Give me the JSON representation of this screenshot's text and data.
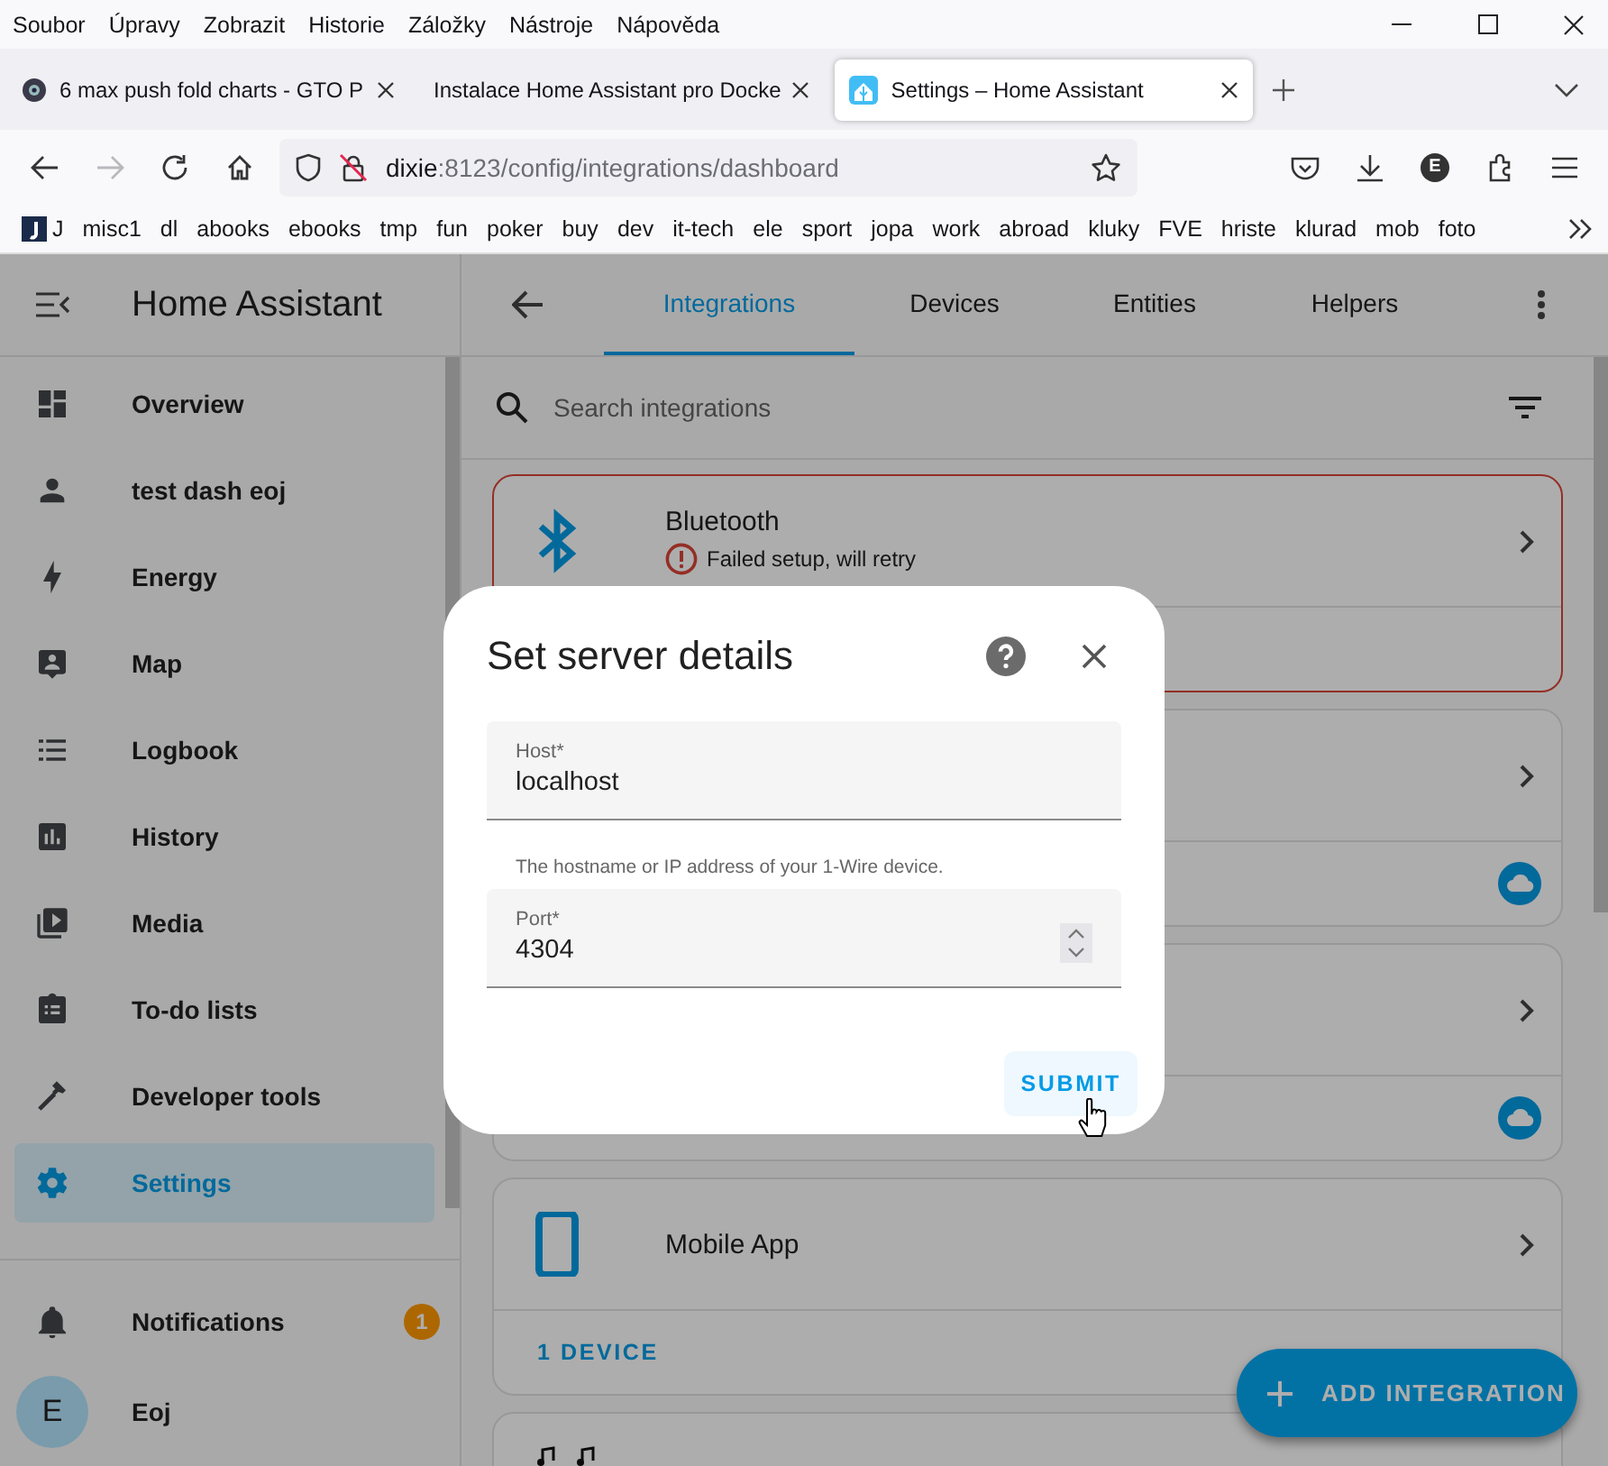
{
  "browser": {
    "menu": [
      "Soubor",
      "Úpravy",
      "Zobrazit",
      "Historie",
      "Záložky",
      "Nástroje",
      "Nápověda"
    ],
    "tabs": [
      {
        "title": "6 max push fold charts - GTO P",
        "selected": false
      },
      {
        "title": "Instalace Home Assistant pro Docke",
        "selected": false
      },
      {
        "title": "Settings – Home Assistant",
        "selected": true
      }
    ],
    "address": {
      "host": "dixie",
      "path": ":8123/config/integrations/dashboard"
    },
    "forward_disabled": true,
    "account_initial": "E",
    "bookmarks": [
      "J",
      "misc1",
      "dl",
      "abooks",
      "ebooks",
      "tmp",
      "fun",
      "poker",
      "buy",
      "dev",
      "it-tech",
      "ele",
      "sport",
      "jopa",
      "work",
      "abroad",
      "kluky",
      "FVE",
      "hriste",
      "klurad",
      "mob",
      "foto"
    ]
  },
  "app": {
    "title": "Home Assistant",
    "sidebar": [
      {
        "label": "Overview",
        "selected": false
      },
      {
        "label": "test dash eoj",
        "selected": false
      },
      {
        "label": "Energy",
        "selected": false
      },
      {
        "label": "Map",
        "selected": false
      },
      {
        "label": "Logbook",
        "selected": false
      },
      {
        "label": "History",
        "selected": false
      },
      {
        "label": "Media",
        "selected": false
      },
      {
        "label": "To-do lists",
        "selected": false
      },
      {
        "label": "Developer tools",
        "selected": false
      },
      {
        "label": "Settings",
        "selected": true
      }
    ],
    "notifications": {
      "label": "Notifications",
      "badge": "1"
    },
    "user": {
      "label": "Eoj",
      "initial": "E"
    }
  },
  "page_tabs": [
    {
      "label": "Integrations",
      "selected": true
    },
    {
      "label": "Devices",
      "selected": false
    },
    {
      "label": "Entities",
      "selected": false
    },
    {
      "label": "Helpers",
      "selected": false
    }
  ],
  "search": {
    "placeholder": "Search integrations"
  },
  "cards": [
    {
      "kind": "error",
      "name": "Bluetooth",
      "status": "Failed setup, will retry"
    },
    {
      "kind": "covered"
    },
    {
      "kind": "covered"
    },
    {
      "kind": "device",
      "name": "Mobile App",
      "footer": "1 DEVICE"
    },
    {
      "kind": "cut"
    }
  ],
  "fab": "ADD INTEGRATION",
  "dialog": {
    "title": "Set server details",
    "host": {
      "label": "Host*",
      "value": "localhost",
      "helper": "The hostname or IP address of your 1-Wire device."
    },
    "port": {
      "label": "Port*",
      "value": "4304"
    },
    "submit": "SUBMIT"
  }
}
